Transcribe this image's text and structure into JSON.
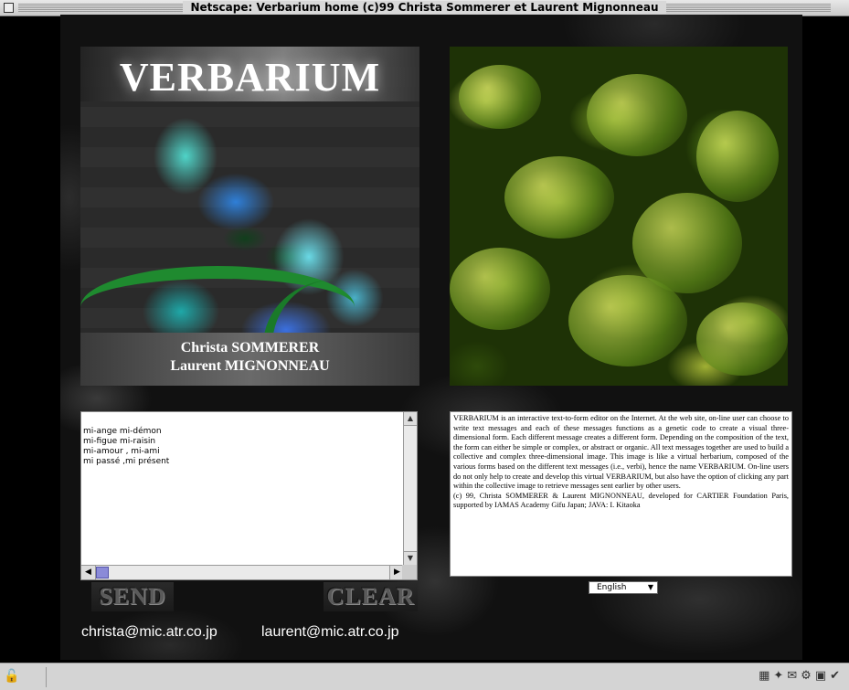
{
  "window": {
    "title": "Netscape: Verbarium home (c)99 Christa Sommerer et Laurent Mignonneau"
  },
  "art_left": {
    "title": "VERBARIUM",
    "credit_line_1": "Christa SOMMERER",
    "credit_line_2": "Laurent MIGNONNEAU"
  },
  "message_box": {
    "lines": [
      "mi-ange mi-démon",
      "mi-figue mi-raisin",
      "mi-amour , mi-ami",
      "mi passé ,mi présent"
    ]
  },
  "buttons": {
    "send_label": "SEND",
    "clear_label": "CLEAR"
  },
  "emails": {
    "christa": "christa@mic.atr.co.jp",
    "laurent": "laurent@mic.atr.co.jp"
  },
  "description": {
    "body": "VERBARIUM is an interactive text-to-form editor on the Internet. At the web site, on-line user can choose to write text messages and each of these messages functions as a genetic code to create a visual three-dimensional form. Each different message creates a different form. Depending on the composition of the text, the form can either be simple or complex, or abstract or organic. All text messages together are used to build a collective and complex three-dimensional image. This image is like a virtual herbarium, composed of the various forms based on the different text messages (i.e., verbi), hence the name VERBARIUM. On-line users do not only help to create and develop this virtual VERBARIUM, but also have the option of clicking any part within the collective image to retrieve messages sent earlier by other users.",
    "footer": "(c) 99, Christa SOMMERER & Laurent MIGNONNEAU, developed for CARTIER Foundation Paris, supported by IAMAS Academy Gifu Japan; JAVA: I. Kitaoka"
  },
  "language_select": {
    "selected": "English"
  },
  "icons": {
    "lock": "lock-icon",
    "status_icons": [
      "component-bar-icons"
    ]
  },
  "colors": {
    "background": "#000000",
    "text_box": "#ffffff",
    "scroll_thumb": "#8b8bd8"
  }
}
